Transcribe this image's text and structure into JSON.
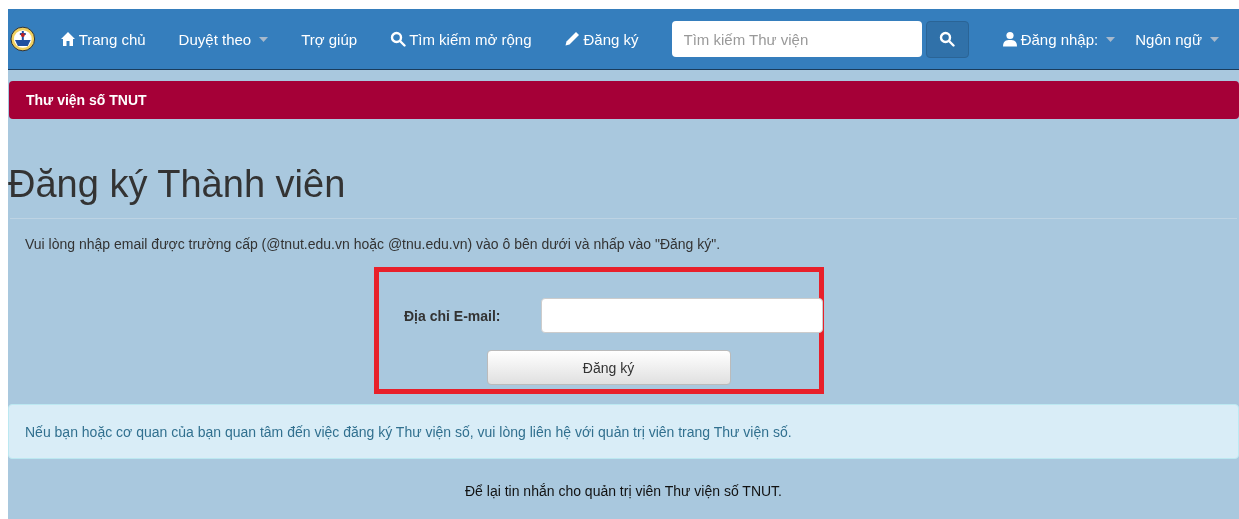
{
  "navbar": {
    "items": [
      {
        "label": "Trang chủ",
        "kind": "home",
        "dropdown": false
      },
      {
        "label": "Duyệt theo",
        "kind": "plain",
        "dropdown": true
      },
      {
        "label": "Trợ giúp",
        "kind": "plain",
        "dropdown": false
      },
      {
        "label": "Tìm kiếm mở rộng",
        "kind": "search",
        "dropdown": false
      },
      {
        "label": "Đăng ký",
        "kind": "pencil",
        "dropdown": false
      }
    ],
    "search": {
      "placeholder": "Tìm kiếm Thư viện"
    },
    "right_items": [
      {
        "label": "Đăng nhập:",
        "kind": "user",
        "dropdown": true
      },
      {
        "label": "Ngôn ngữ",
        "kind": "plain",
        "dropdown": true
      }
    ]
  },
  "breadcrumb": "Thư viện số TNUT",
  "heading": "Đăng ký Thành viên",
  "instruction": "Vui lòng nhập email được trường cấp (@tnut.edu.vn hoặc @tnu.edu.vn) vào ô bên dưới và nhấp vào \"Đăng ký\".",
  "form": {
    "email_label": "Địa chỉ E-mail:",
    "submit": "Đăng ký",
    "highlighted": true
  },
  "info_alert": "Nếu bạn hoặc cơ quan của bạn quan tâm đến việc đăng ký Thư viện số, vui lòng liên hệ với quản trị viên trang Thư viện số.",
  "footer_link": "Để lại tin nhắn cho quản trị viên Thư viện số TNUT."
}
